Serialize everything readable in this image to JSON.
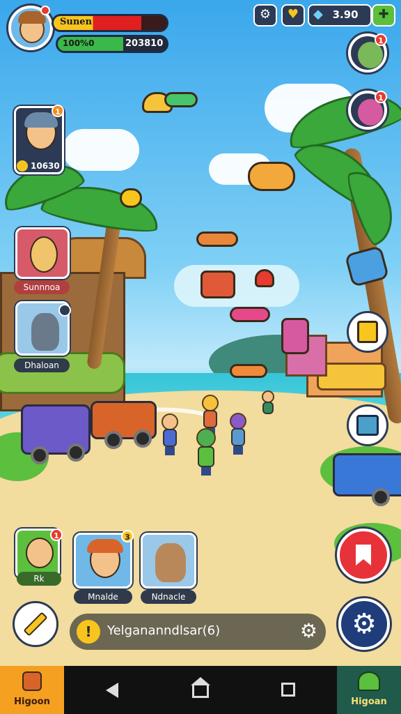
{
  "player": {
    "name": "Sunen",
    "xp_text": "100%0",
    "coins_text": "203810",
    "health_fraction": 0.78,
    "xp_fraction": 0.6
  },
  "top_bar": {
    "icons": [
      "gear-icon",
      "crest-icon",
      "gem-icon"
    ],
    "currency_text": "3.90"
  },
  "friends_left": [
    {
      "name": "",
      "coins": "10630",
      "badge": "1"
    },
    {
      "name": "Sunnnoa"
    },
    {
      "name": "Dhaloan"
    }
  ],
  "friends_right": [
    {
      "badge": "1"
    },
    {
      "badge": "1"
    }
  ],
  "bottom_cards": [
    {
      "name": "Rk",
      "badge": "1"
    },
    {
      "name": "Mnalde",
      "badge": "3"
    },
    {
      "name": "Ndnacle"
    }
  ],
  "status": {
    "icon": "!",
    "text": "Yelgananndlsar(6)"
  },
  "bottom_tabs": {
    "left": "Higoon",
    "right": "Higoan"
  },
  "colors": {
    "health": "#e02020",
    "xp": "#3bb84a",
    "accent": "#f7c51e",
    "button_red": "#e8323a",
    "button_navy": "#1f3d7a"
  }
}
